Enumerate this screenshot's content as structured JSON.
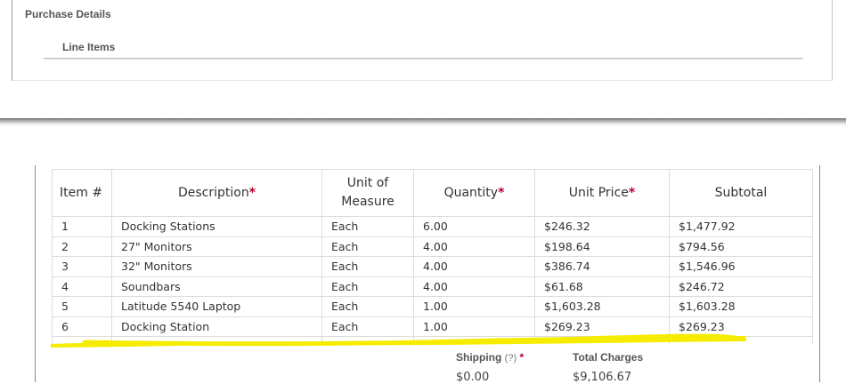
{
  "purchase_details": {
    "title": "Purchase Details",
    "line_items_title": "Line Items"
  },
  "table": {
    "headers": {
      "item": "Item #",
      "description": "Description",
      "unit_of_measure_1": "Unit of",
      "unit_of_measure_2": "Measure",
      "quantity": "Quantity",
      "unit_price": "Unit Price",
      "subtotal": "Subtotal",
      "required_mark": "*"
    },
    "rows": [
      {
        "item": "1",
        "description": "Docking Stations",
        "uom": "Each",
        "qty": "6.00",
        "price": "$246.32",
        "subtotal": "$1,477.92"
      },
      {
        "item": "2",
        "description": "27\" Monitors",
        "uom": "Each",
        "qty": "4.00",
        "price": "$198.64",
        "subtotal": "$794.56"
      },
      {
        "item": "3",
        "description": "32\" Monitors",
        "uom": "Each",
        "qty": "4.00",
        "price": "$386.74",
        "subtotal": "$1,546.96"
      },
      {
        "item": "4",
        "description": "Soundbars",
        "uom": "Each",
        "qty": "4.00",
        "price": "$61.68",
        "subtotal": "$246.72"
      },
      {
        "item": "5",
        "description": "Latitude 5540 Laptop",
        "uom": "Each",
        "qty": "1.00",
        "price": "$1,603.28",
        "subtotal": "$1,603.28"
      },
      {
        "item": "6",
        "description": "Docking Station",
        "uom": "Each",
        "qty": "1.00",
        "price": "$269.23",
        "subtotal": "$269.23"
      }
    ]
  },
  "summary": {
    "shipping_label": "Shipping",
    "shipping_hint": "(?)",
    "required_mark": "*",
    "shipping_value": "$0.00",
    "total_label": "Total Charges",
    "total_value": "$9,106.67"
  },
  "colors": {
    "required": "#b8002e",
    "highlighter": "#f5ec00"
  }
}
